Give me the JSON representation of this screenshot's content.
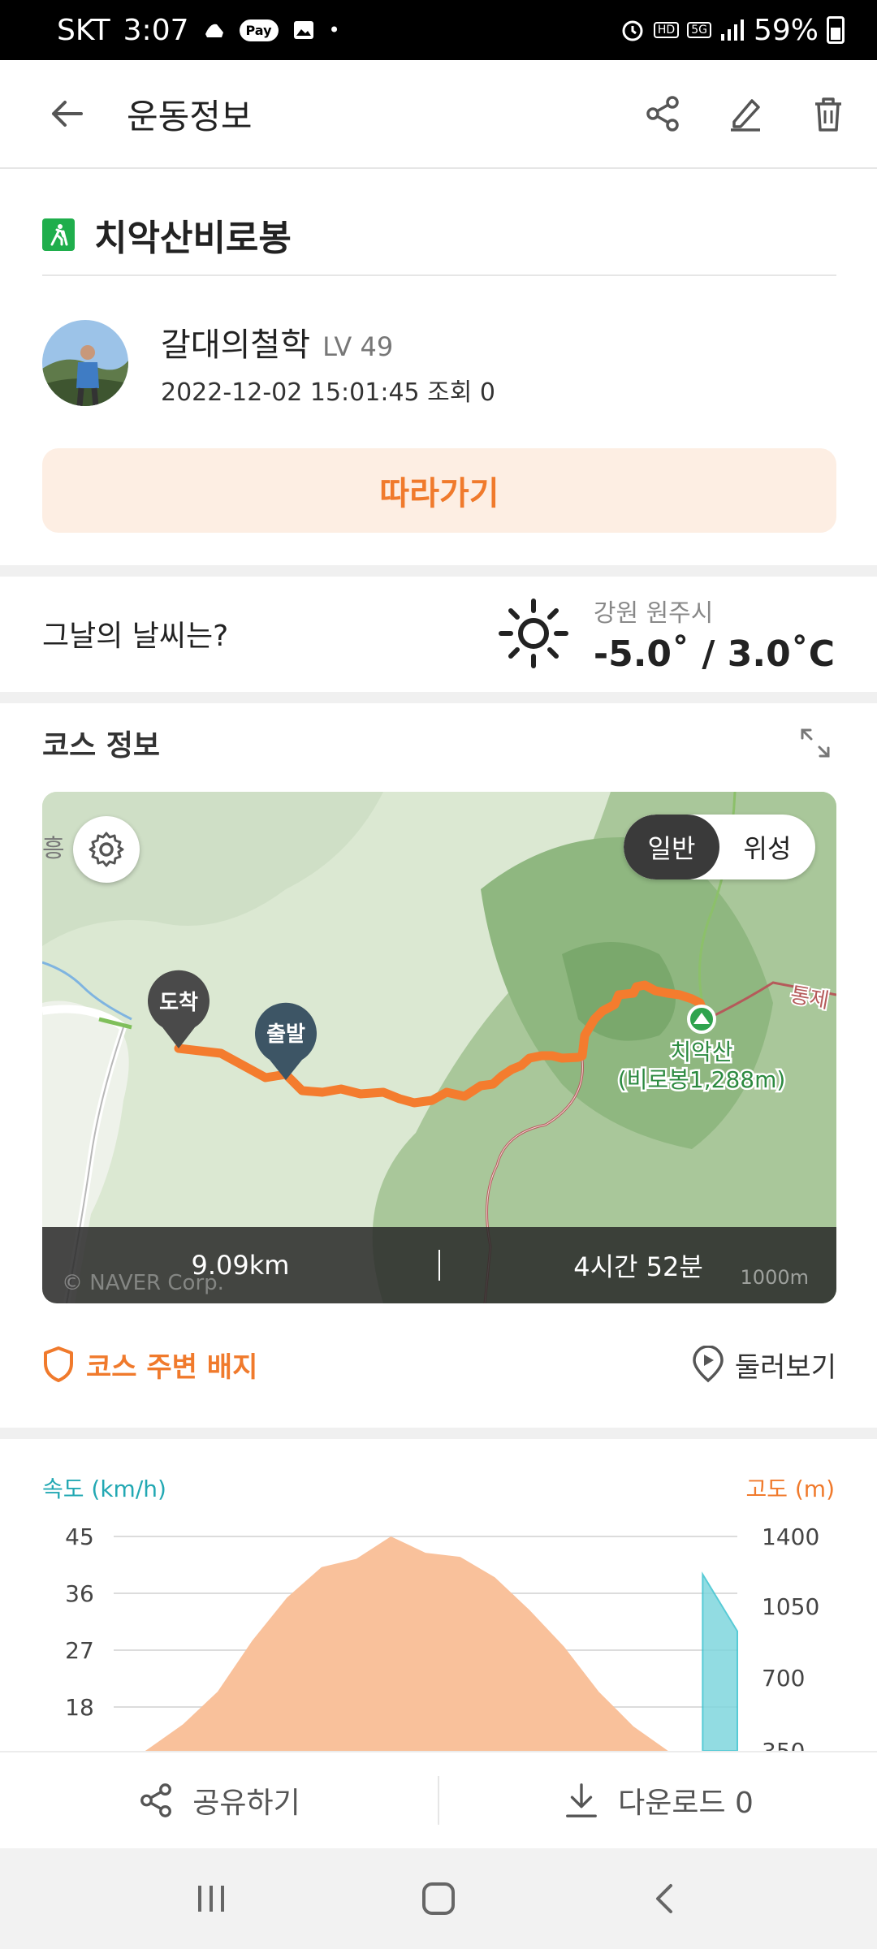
{
  "status_bar": {
    "carrier": "SKT",
    "time": "3:07",
    "pay": "Pay",
    "hd": "HD",
    "net": "5G",
    "battery": "59%"
  },
  "header": {
    "title": "운동정보"
  },
  "course": {
    "title": "치악산비로봉"
  },
  "user": {
    "name": "갈대의철학",
    "level": "LV 49",
    "datetime": "2022-12-02 15:01:45",
    "views": "조회 0"
  },
  "follow_button": "따라가기",
  "weather": {
    "question": "그날의 날씨는?",
    "location": "강원 원주시",
    "temperature": "-5.0˚ / 3.0˚C"
  },
  "course_info": {
    "label": "코스 정보"
  },
  "map": {
    "toggle_normal": "일반",
    "toggle_satellite": "위성",
    "arrive_marker": "도착",
    "start_marker": "출발",
    "peak_name": "치악산",
    "peak_sub": "(비로봉1,288m)",
    "road_label": "통제",
    "left_label": "흥",
    "distance": "9.09km",
    "duration": "4시간 52분",
    "copyright": "© NAVER Corp.",
    "scale": "1000m"
  },
  "badges": {
    "label": "코스 주변 배지",
    "look_around": "둘러보기"
  },
  "chart_data": {
    "type": "area",
    "left_axis_label": "속도 (km/h)",
    "right_axis_label": "고도 (m)",
    "left_ticks": [
      "45",
      "36",
      "27",
      "18"
    ],
    "right_ticks": [
      "1400",
      "1050",
      "700",
      "350"
    ],
    "series": [
      {
        "name": "고도 (m)",
        "color": "#f9c19b",
        "axis": "right",
        "values": [
          250,
          360,
          480,
          640,
          890,
          1100,
          1250,
          1290,
          1400,
          1320,
          1300,
          1200,
          1040,
          860,
          640,
          470,
          350,
          280,
          200
        ]
      },
      {
        "name": "속도 (km/h)",
        "color": "#7fd6dd",
        "axis": "left",
        "values": [
          0,
          0,
          0,
          0,
          0,
          0,
          0,
          0,
          0,
          0,
          0,
          0,
          0,
          0,
          0,
          0,
          0,
          39,
          30
        ]
      }
    ]
  },
  "bottom_actions": {
    "share": "공유하기",
    "download": "다운로드 0"
  }
}
